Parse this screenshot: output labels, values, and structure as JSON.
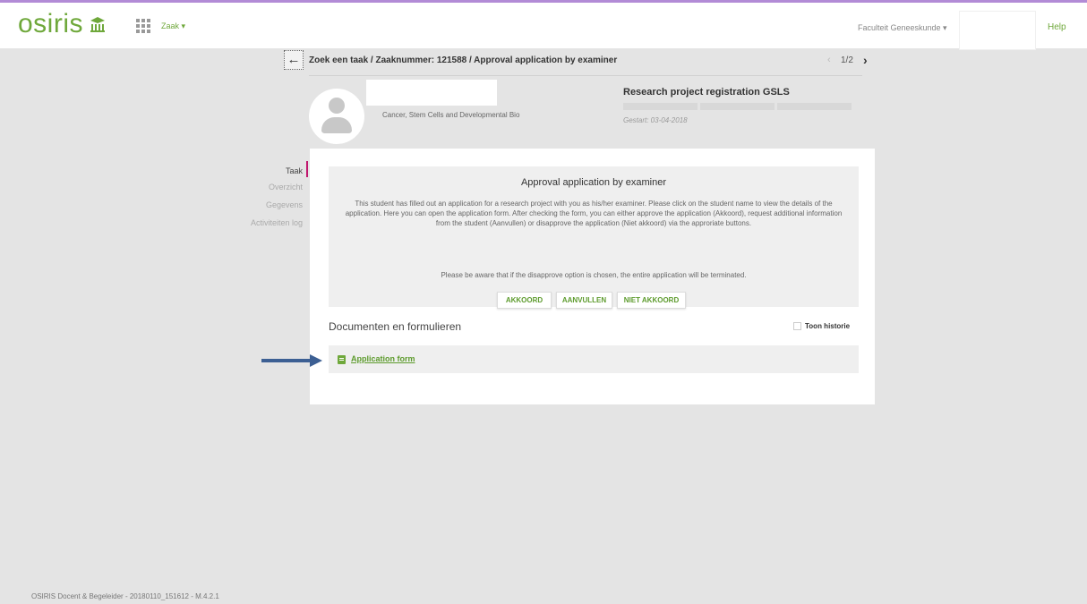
{
  "header": {
    "logo": "osiris",
    "zaak_menu": "Zaak ▾",
    "faculty": "Faculteit Geneeskunde ▾",
    "help": "Help"
  },
  "breadcrumb": {
    "text": "Zoek een taak / Zaaknummer: 121588 / Approval application by examiner",
    "pager": "1/2"
  },
  "student": {
    "department": "Cancer, Stem Cells and Developmental Bio"
  },
  "project": {
    "title": "Research project registration GSLS",
    "started": "Gestart: 03-04-2018"
  },
  "nav": {
    "items": [
      "Taak",
      "Overzicht",
      "Gegevens",
      "Activiteiten log"
    ],
    "active": "Taak"
  },
  "approval": {
    "title": "Approval application by examiner",
    "description": "This student has filled out an application for a research project with you as his/her examiner. Please click on the student name to view the details of the application. Here you can open the application form. After checking the form, you can either approve the application (Akkoord), request additional information from the student (Aanvullen) or disapprove the application (Niet akkoord) via the approriate buttons.",
    "warning": "Please be aware that if the disapprove option is chosen, the entire application will be terminated.",
    "buttons": [
      "AKKOORD",
      "AANVULLEN",
      "NIET AKKOORD"
    ]
  },
  "documents": {
    "title": "Documenten en formulieren",
    "history_label": "Toon historie",
    "items": [
      "Application form"
    ]
  },
  "footer": "OSIRIS Docent & Begeleider - 20180110_151612 - M.4.2.1",
  "colors": {
    "brand_green": "#6fa83b",
    "nav_marker": "#c0176e",
    "arrow": "#3c5f93"
  }
}
